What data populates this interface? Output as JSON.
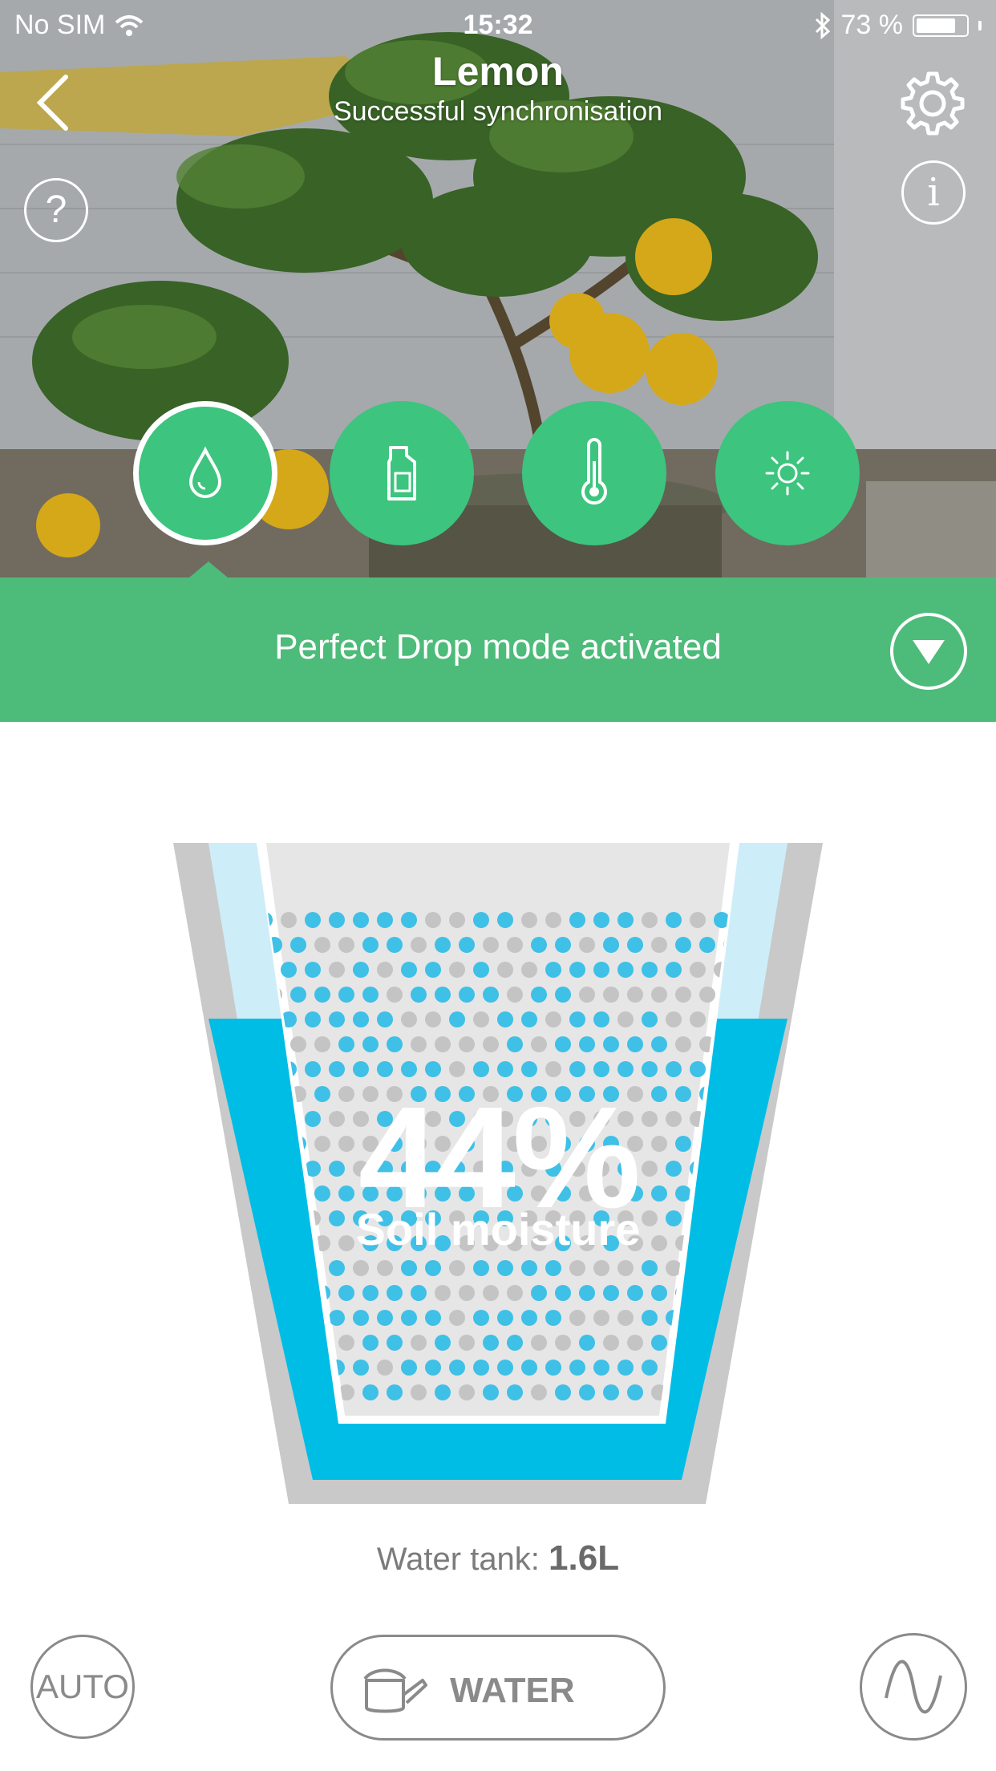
{
  "status_bar": {
    "carrier": "No SIM",
    "time": "15:32",
    "battery": "73 %",
    "battery_level": 0.73
  },
  "header": {
    "title": "Lemon",
    "subtitle": "Successful synchronisation"
  },
  "header_icons": {
    "back": "chevron-left-icon",
    "settings": "gear-icon",
    "help": "?",
    "info": "i"
  },
  "tabs": [
    {
      "icon": "water-drop-icon",
      "active": true
    },
    {
      "icon": "fertilizer-icon",
      "active": false
    },
    {
      "icon": "thermometer-icon",
      "active": false
    },
    {
      "icon": "sun-icon",
      "active": false
    }
  ],
  "banner": {
    "text": "Perfect Drop mode activated"
  },
  "moisture": {
    "value": "44%",
    "label": "Soil moisture",
    "level": 0.44
  },
  "tank": {
    "label": "Water tank:",
    "value": "1.6L"
  },
  "controls": {
    "auto_label": "AUTO",
    "water_label": "WATER"
  },
  "colors": {
    "brand_green": "#4dbb79",
    "tab_green": "#3dc47e",
    "water_blue": "#00bde6",
    "light_blue": "#cdeef8",
    "soil_grey": "#c4c4c4"
  }
}
